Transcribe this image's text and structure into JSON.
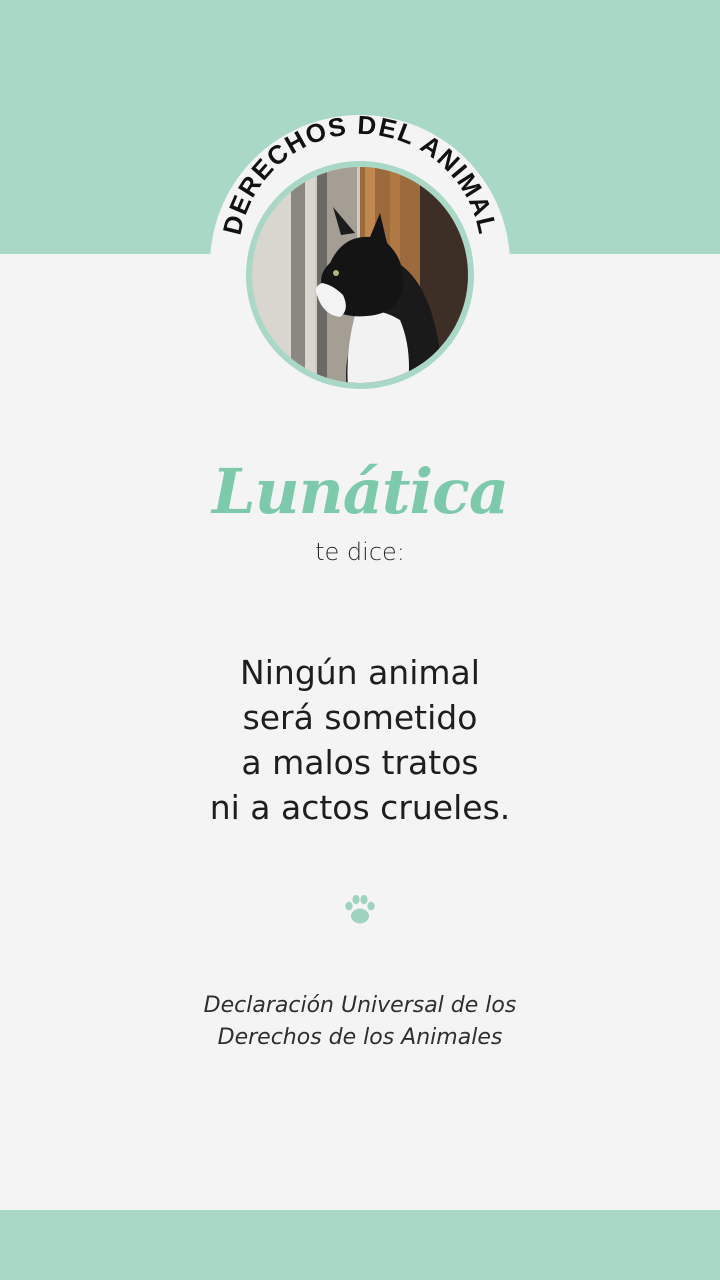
{
  "colors": {
    "accent": "#aad8c7",
    "title": "#7cc9ac",
    "background": "#f4f4f4"
  },
  "badge": {
    "arc_text": "DERECHOS DEL ANIMAL",
    "photo": "black-and-white-cat-at-window"
  },
  "title": {
    "name": "Lunática",
    "subtitle": "te dice:"
  },
  "quote": {
    "lines": [
      "Ningún animal",
      "será sometido",
      "a malos tratos",
      "ni a actos crueles."
    ]
  },
  "paw_icon": "paw-icon",
  "source": {
    "lines": [
      "Declaración Universal de los",
      "Derechos de los Animales"
    ]
  }
}
